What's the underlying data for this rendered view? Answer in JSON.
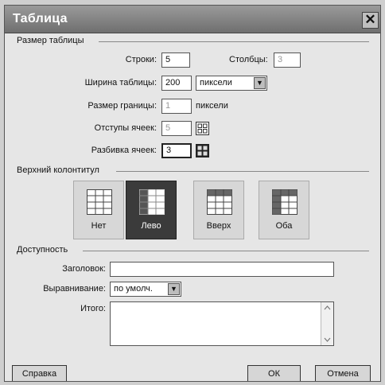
{
  "dialog": {
    "title": "Таблица",
    "close_symbol": "✕"
  },
  "table_size": {
    "group_label": "Размер таблицы",
    "rows_label": "Строки:",
    "rows_value": "5",
    "cols_label": "Столбцы:",
    "cols_value": "3",
    "width_label": "Ширина таблицы:",
    "width_value": "200",
    "width_unit": "пиксели",
    "border_label": "Размер границы:",
    "border_value": "1",
    "border_unit": "пиксели",
    "padding_label": "Отступы ячеек:",
    "padding_value": "5",
    "spacing_label": "Разбивка ячеек:",
    "spacing_value": "3"
  },
  "header": {
    "group_label": "Верхний колонтитул",
    "options": [
      {
        "label": "Нет",
        "icon": "table-no-header-icon",
        "selected": false
      },
      {
        "label": "Лево",
        "icon": "table-left-header-icon",
        "selected": true
      },
      {
        "label": "Вверх",
        "icon": "table-top-header-icon",
        "selected": false
      },
      {
        "label": "Оба",
        "icon": "table-both-header-icon",
        "selected": false
      }
    ]
  },
  "accessibility": {
    "group_label": "Доступность",
    "caption_label": "Заголовок:",
    "caption_value": "",
    "align_label": "Выравнивание:",
    "align_value": "по умолч.",
    "summary_label": "Итого:",
    "summary_value": ""
  },
  "buttons": {
    "help": "Справка",
    "ok": "ОК",
    "cancel": "Отмена"
  },
  "colors": {
    "titlebar": "#7f7f7f",
    "selected_option": "#3b3b3b",
    "dialog_bg": "#e6e6e6"
  }
}
